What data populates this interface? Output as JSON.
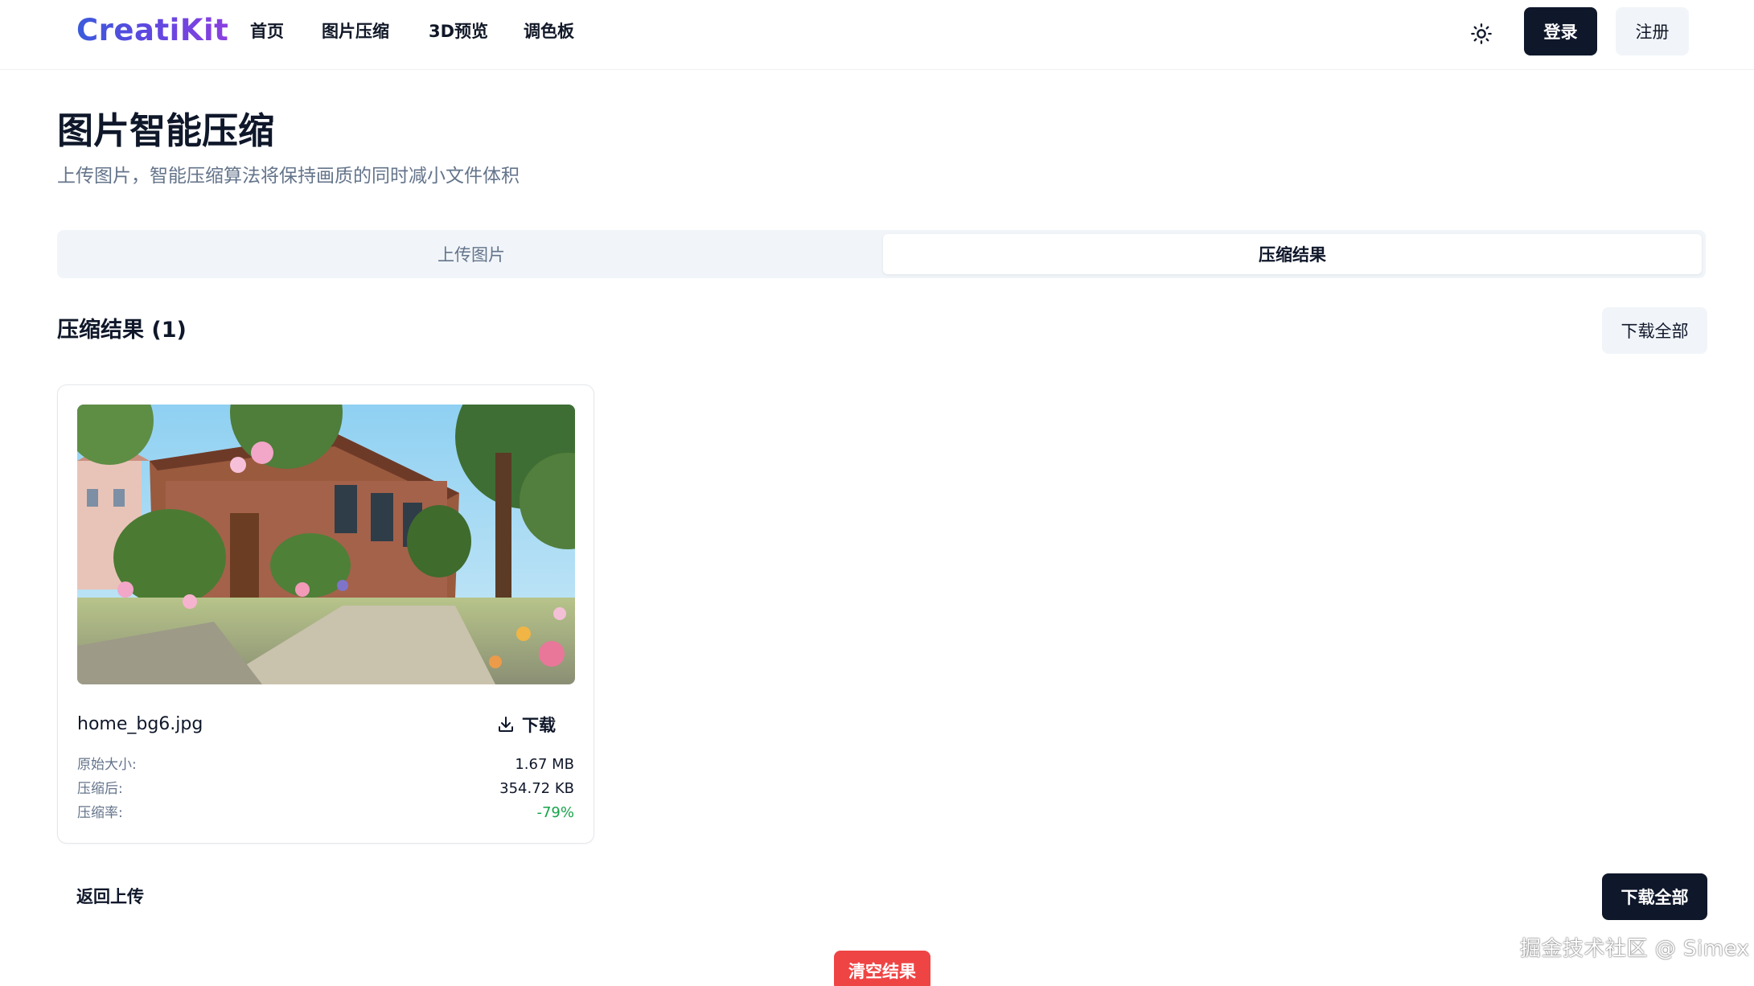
{
  "header": {
    "logo": "CreatiKit",
    "nav": [
      "首页",
      "图片压缩",
      "3D预览",
      "调色板"
    ],
    "theme_icon": "sun-icon",
    "login_label": "登录",
    "register_label": "注册"
  },
  "page": {
    "title": "图片智能压缩",
    "subtitle": "上传图片，智能压缩算法将保持画质的同时减小文件体积"
  },
  "tabs": {
    "upload": "上传图片",
    "results": "压缩结果",
    "active": "results"
  },
  "results": {
    "title": "压缩结果 (1)",
    "download_all_label": "下载全部",
    "items": [
      {
        "file_name": "home_bg6.jpg",
        "download_label": "下载",
        "download_icon": "download-icon",
        "original_label": "原始大小:",
        "original_value": "1.67 MB",
        "compressed_label": "压缩后:",
        "compressed_value": "354.72 KB",
        "ratio_label": "压缩率:",
        "ratio_value": "-79%"
      }
    ]
  },
  "actions": {
    "back_label": "返回上传",
    "download_all_label": "下载全部",
    "clear_label": "清空结果"
  },
  "watermark": "掘金技术社区 @ Simex",
  "colors": {
    "primary": "#0f172a",
    "muted": "#64748b",
    "tab_bg": "#f1f5f9",
    "success": "#16a34a",
    "danger": "#ef4444",
    "logo_gradient_start": "#3b5bdb",
    "logo_gradient_end": "#8b3fe0"
  }
}
